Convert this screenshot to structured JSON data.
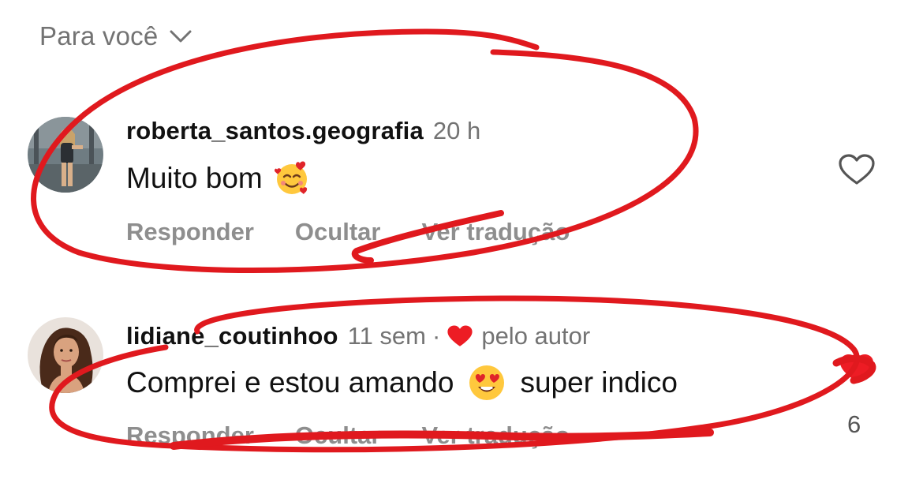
{
  "sort": {
    "label": "Para você"
  },
  "comments": [
    {
      "username": "roberta_santos.geografia",
      "time": "20 h",
      "text": "Muito bom",
      "emoji": "smiling-face-with-hearts",
      "actions": {
        "reply": "Responder",
        "hide": "Ocultar",
        "translate": "Ver tradução"
      },
      "liked": false
    },
    {
      "username": "lidiane_coutinhoo",
      "time": "11 sem",
      "separator": "·",
      "author_like": "pelo autor",
      "text_before": "Comprei e estou amando",
      "emoji": "heart-eyes",
      "text_after": "super indico",
      "actions": {
        "reply": "Responder",
        "hide": "Ocultar",
        "translate": "Ver tradução"
      },
      "liked": true,
      "like_count": "6"
    }
  ],
  "colors": {
    "annotation": "#e0191e",
    "like": "#ed1c24",
    "muted": "#737373"
  }
}
